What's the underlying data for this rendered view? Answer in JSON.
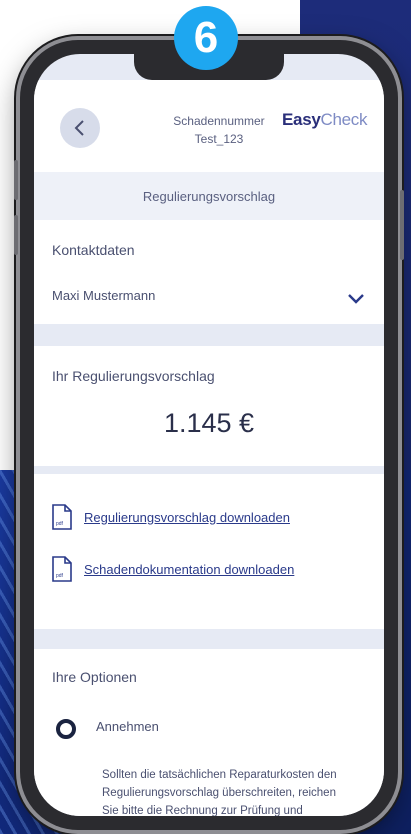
{
  "step": "6",
  "header": {
    "label": "Schadennummer",
    "value": "Test_123",
    "logo_bold": "Easy",
    "logo_light": "Check"
  },
  "section_title": "Regulierungsvorschlag",
  "contact": {
    "heading": "Kontaktdaten",
    "name": "Maxi Mustermann"
  },
  "proposal": {
    "heading": "Ihr Regulierungsvorschlag",
    "amount": "1.145 €"
  },
  "downloads": [
    {
      "label": "Regulierungsvorschlag downloaden"
    },
    {
      "label": "Schadendokumentation downloaden"
    }
  ],
  "options": {
    "heading": "Ihre Optionen",
    "accept_label": "Annehmen",
    "description": "Sollten die tatsächlichen Reparaturkosten den Regulierungsvorschlag überschreiten, reichen Sie bitte die Rechnung zur Prüfung und Erstattung des"
  }
}
